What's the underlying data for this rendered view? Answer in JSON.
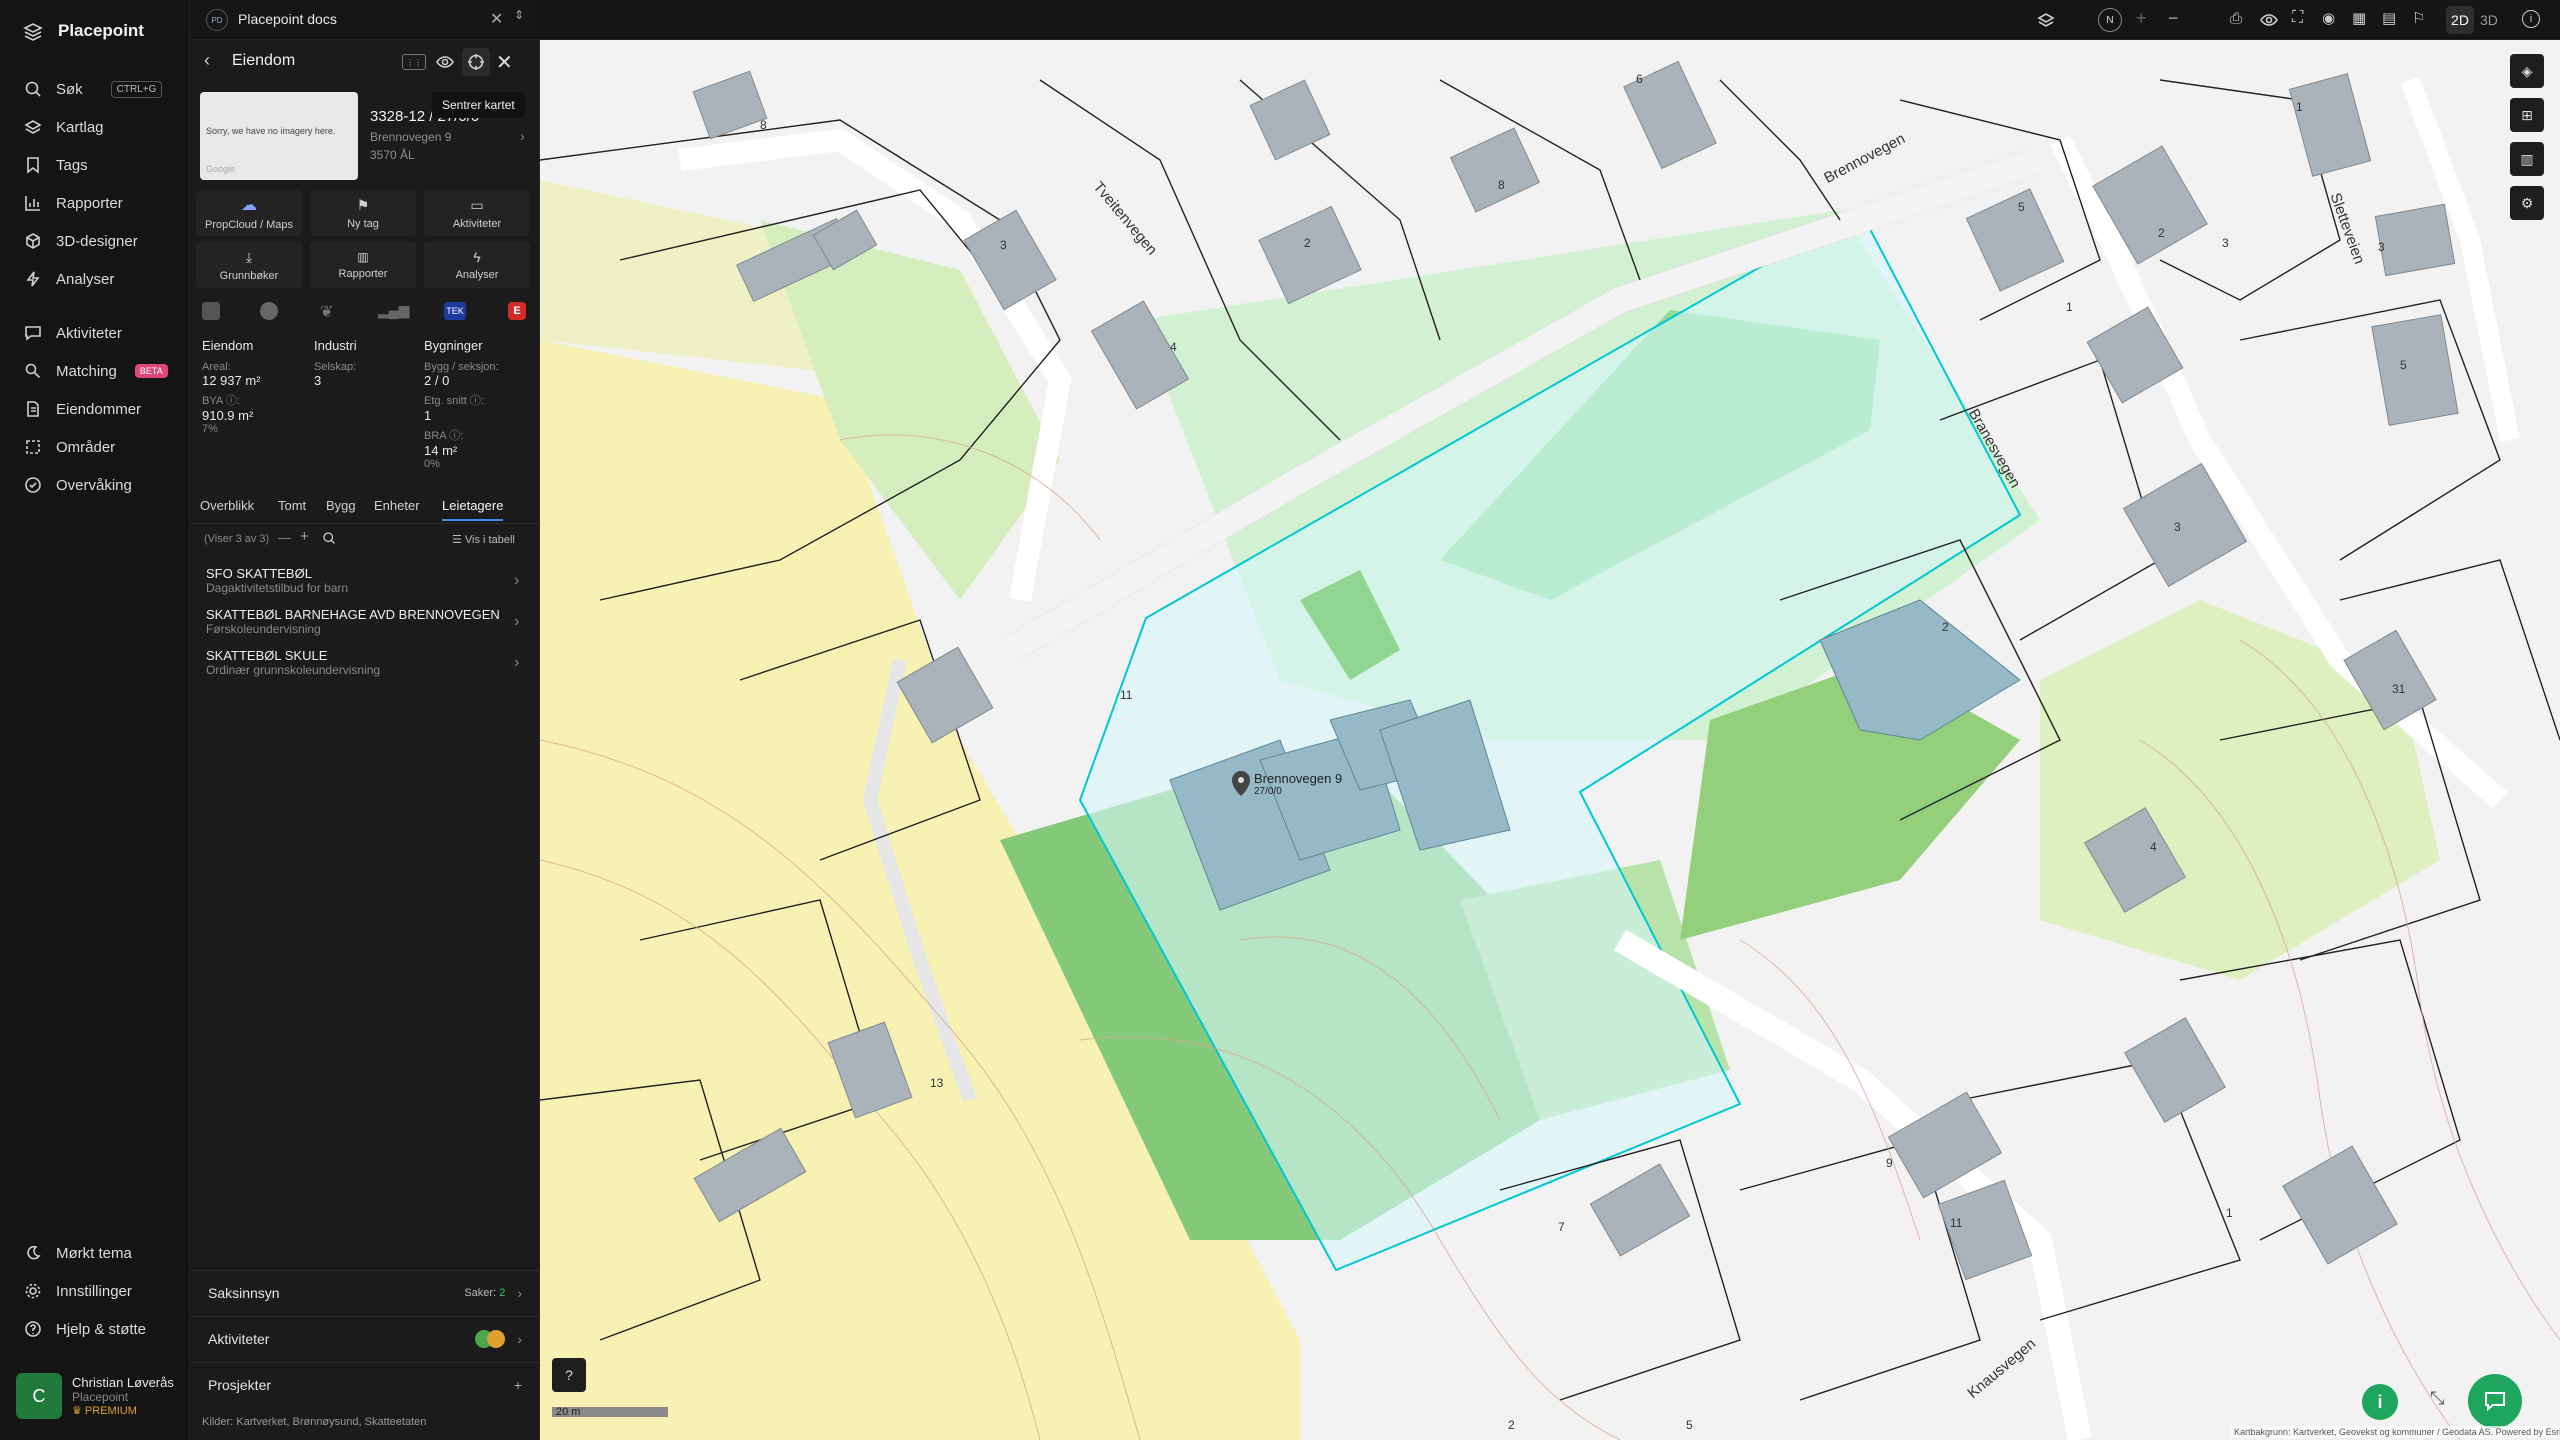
{
  "app": {
    "name": "Placepoint"
  },
  "nav": {
    "items": [
      {
        "label": "Søk",
        "shortcut": "CTRL+G"
      },
      {
        "label": "Kartlag"
      },
      {
        "label": "Tags"
      },
      {
        "label": "Rapporter"
      },
      {
        "label": "3D-designer"
      },
      {
        "label": "Analyser"
      },
      {
        "label": "Aktiviteter"
      },
      {
        "label": "Matching",
        "badge": "BETA"
      },
      {
        "label": "Eiendommer"
      },
      {
        "label": "Områder"
      },
      {
        "label": "Overvåking"
      }
    ],
    "bottom": [
      {
        "label": "Mørkt tema"
      },
      {
        "label": "Innstillinger"
      },
      {
        "label": "Hjelp & støtte"
      }
    ],
    "user": {
      "initial": "C",
      "name": "Christian Løverås",
      "org": "Placepoint",
      "plan": "PREMIUM"
    }
  },
  "workspace": {
    "badge": "PD",
    "name": "Placepoint docs"
  },
  "panel": {
    "title": "Eiendom",
    "tooltip": "Sentrer kartet",
    "imagery_text": "Sorry, we have no imagery here.",
    "imagery_credit": "Google",
    "property_id": "3328-12 / 27/0/0",
    "address": "Brennovegen 9",
    "postal": "3570 ÅL",
    "actions": [
      {
        "label": "PropCloud / Maps"
      },
      {
        "label": "Ny tag"
      },
      {
        "label": "Aktiviteter"
      },
      {
        "label": "Grunnbøker"
      },
      {
        "label": "Rapporter"
      },
      {
        "label": "Analyser"
      }
    ],
    "sources": {
      "tek": "TEK",
      "e": "E"
    },
    "stats": {
      "eiendom": {
        "heading": "Eiendom",
        "areal_label": "Areal:",
        "areal": "12 937 m²",
        "bya_label": "BYA ⓘ:",
        "bya": "910.9 m²",
        "bya_pct": "7%"
      },
      "industri": {
        "heading": "Industri",
        "selskap_label": "Selskap:",
        "selskap": "3"
      },
      "bygninger": {
        "heading": "Bygninger",
        "bygg_label": "Bygg / seksjon:",
        "bygg": "2 / 0",
        "etg_label": "Etg. snitt ⓘ:",
        "etg": "1",
        "bra_label": "BRA ⓘ:",
        "bra": "14 m²",
        "bra_pct": "0%"
      }
    },
    "tabs": [
      "Overblikk",
      "Tomt",
      "Bygg",
      "Enheter",
      "Leietagere"
    ],
    "list_meta": "(Viser 3 av 3)",
    "table_link": "Vis i tabell",
    "tenants": [
      {
        "name": "SFO SKATTEBØL",
        "desc": "Dagaktivitetstilbud for barn"
      },
      {
        "name": "SKATTEBØL BARNEHAGE AVD BRENNOVEGEN",
        "desc": "Førskoleundervisning"
      },
      {
        "name": "SKATTEBØL SKULE",
        "desc": "Ordinær grunnskoleundervisning"
      }
    ],
    "sections": [
      {
        "label": "Saksinnsyn",
        "meta": "Saker:",
        "count": "2"
      },
      {
        "label": "Aktiviteter"
      },
      {
        "label": "Prosjekter"
      }
    ],
    "sources_footer": "Kilder: Kartverket, Brønnøysund, Skatteetaten"
  },
  "map": {
    "mode_2d": "2D",
    "mode_3d": "3D",
    "compass": "N",
    "marker_label": "Brennovegen 9",
    "marker_sub": "27/0/0",
    "scale": "20 m",
    "attribution": "Kartbakgrunn: Kartverket, Geovekst og kommuner / Geodata AS. Powered by Esri",
    "streets": [
      "Brennovegen",
      "Tveitenvegen",
      "Branesvegen",
      "Sletteveien",
      "Knausvegen"
    ],
    "house_numbers": [
      "8",
      "3",
      "2",
      "4",
      "8",
      "6",
      "1",
      "5",
      "2",
      "3",
      "1",
      "3",
      "5",
      "11",
      "3",
      "2",
      "31",
      "4",
      "13",
      "9",
      "7",
      "11",
      "1",
      "2",
      "5"
    ],
    "colors": {
      "parcel": "#00c8d2",
      "green": "#8fd38c",
      "yellow": "#f8f3b4",
      "building": "#9ab5c2"
    }
  }
}
